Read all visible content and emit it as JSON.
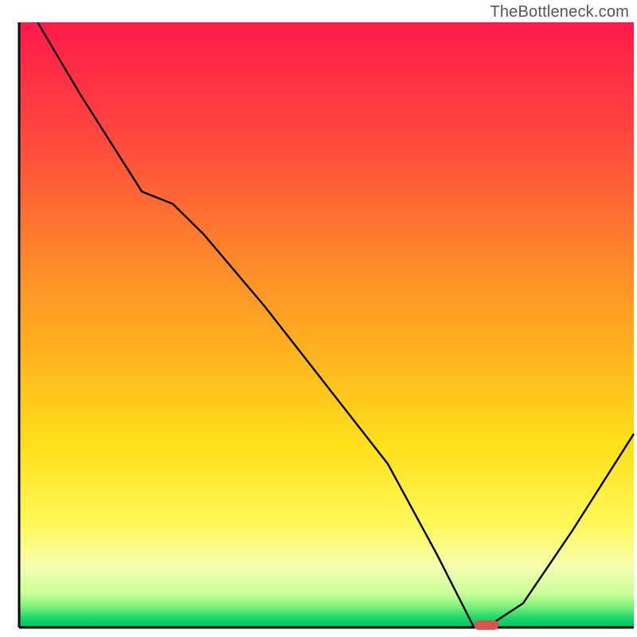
{
  "watermark": "TheBottleneck.com",
  "chart_data": {
    "type": "line",
    "title": "",
    "xlabel": "",
    "ylabel": "",
    "xlim": [
      0,
      100
    ],
    "ylim": [
      0,
      100
    ],
    "grid": false,
    "legend": false,
    "x": [
      3,
      10,
      20,
      25,
      30,
      40,
      50,
      60,
      68,
      74,
      76,
      82,
      90,
      100
    ],
    "values": [
      100,
      88,
      72,
      70,
      65,
      53,
      40,
      27,
      12,
      0,
      0,
      4,
      16,
      32
    ],
    "marker": {
      "x_range": [
        74,
        78
      ],
      "y": 0,
      "color": "#d9544f"
    },
    "gradient_stops": [
      {
        "offset": 0.0,
        "color": "#ff1a4b"
      },
      {
        "offset": 0.2,
        "color": "#ff4a3e"
      },
      {
        "offset": 0.4,
        "color": "#ff8a2a"
      },
      {
        "offset": 0.55,
        "color": "#ffb41f"
      },
      {
        "offset": 0.7,
        "color": "#ffe01a"
      },
      {
        "offset": 0.83,
        "color": "#fff85a"
      },
      {
        "offset": 0.9,
        "color": "#f6ffb0"
      },
      {
        "offset": 0.945,
        "color": "#c8ff9a"
      },
      {
        "offset": 0.965,
        "color": "#7ef27a"
      },
      {
        "offset": 0.985,
        "color": "#1bd66b"
      },
      {
        "offset": 1.0,
        "color": "#00c463"
      }
    ],
    "axis_color": "#000000",
    "line_color": "#000000"
  }
}
